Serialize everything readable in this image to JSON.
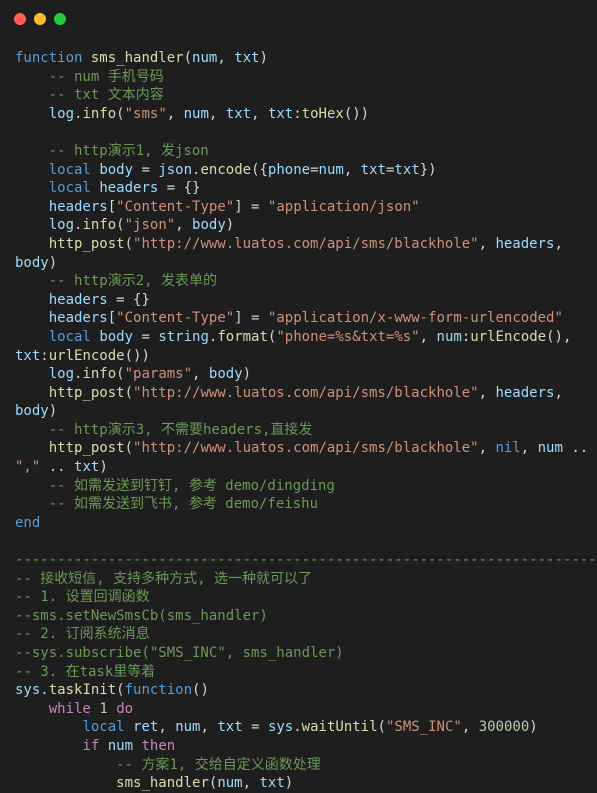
{
  "window": {
    "buttons": {
      "close_color": "#ff5f56",
      "minimize_color": "#ffbd2e",
      "maximize_color": "#27c93f"
    }
  },
  "theme": {
    "background": "#1e1e1e",
    "keyword": "#c586c0",
    "keyword_blue": "#569cd6",
    "function": "#dcdcaa",
    "variable": "#9cdcfe",
    "string": "#ce9178",
    "comment": "#6a9955",
    "number": "#b5cea8",
    "plain": "#d4d4d4"
  },
  "code": {
    "lines": [
      [
        [
          "kwb",
          "function"
        ],
        [
          "plain",
          " "
        ],
        [
          "fn",
          "sms_handler"
        ],
        [
          "plain",
          "("
        ],
        [
          "var",
          "num"
        ],
        [
          "plain",
          ", "
        ],
        [
          "var",
          "txt"
        ],
        [
          "plain",
          ")"
        ]
      ],
      [
        [
          "plain",
          "    "
        ],
        [
          "com",
          "-- num 手机号码"
        ]
      ],
      [
        [
          "plain",
          "    "
        ],
        [
          "com",
          "-- txt 文本内容"
        ]
      ],
      [
        [
          "plain",
          "    "
        ],
        [
          "var",
          "log"
        ],
        [
          "plain",
          "."
        ],
        [
          "fn",
          "info"
        ],
        [
          "plain",
          "("
        ],
        [
          "str",
          "\"sms\""
        ],
        [
          "plain",
          ", "
        ],
        [
          "var",
          "num"
        ],
        [
          "plain",
          ", "
        ],
        [
          "var",
          "txt"
        ],
        [
          "plain",
          ", "
        ],
        [
          "var",
          "txt"
        ],
        [
          "plain",
          ":"
        ],
        [
          "fn",
          "toHex"
        ],
        [
          "plain",
          "())"
        ]
      ],
      [
        [
          "plain",
          ""
        ]
      ],
      [
        [
          "plain",
          "    "
        ],
        [
          "com",
          "-- http演示1, 发json"
        ]
      ],
      [
        [
          "plain",
          "    "
        ],
        [
          "kwb",
          "local"
        ],
        [
          "plain",
          " "
        ],
        [
          "var",
          "body"
        ],
        [
          "plain",
          " = "
        ],
        [
          "var",
          "json"
        ],
        [
          "plain",
          "."
        ],
        [
          "fn",
          "encode"
        ],
        [
          "plain",
          "({"
        ],
        [
          "var",
          "phone"
        ],
        [
          "plain",
          "="
        ],
        [
          "var",
          "num"
        ],
        [
          "plain",
          ", "
        ],
        [
          "var",
          "txt"
        ],
        [
          "plain",
          "="
        ],
        [
          "var",
          "txt"
        ],
        [
          "plain",
          "})"
        ]
      ],
      [
        [
          "plain",
          "    "
        ],
        [
          "kwb",
          "local"
        ],
        [
          "plain",
          " "
        ],
        [
          "var",
          "headers"
        ],
        [
          "plain",
          " = {}"
        ]
      ],
      [
        [
          "plain",
          "    "
        ],
        [
          "var",
          "headers"
        ],
        [
          "plain",
          "["
        ],
        [
          "str",
          "\"Content-Type\""
        ],
        [
          "plain",
          "] = "
        ],
        [
          "str",
          "\"application/json\""
        ]
      ],
      [
        [
          "plain",
          "    "
        ],
        [
          "var",
          "log"
        ],
        [
          "plain",
          "."
        ],
        [
          "fn",
          "info"
        ],
        [
          "plain",
          "("
        ],
        [
          "str",
          "\"json\""
        ],
        [
          "plain",
          ", "
        ],
        [
          "var",
          "body"
        ],
        [
          "plain",
          ")"
        ]
      ],
      [
        [
          "plain",
          "    "
        ],
        [
          "fn",
          "http_post"
        ],
        [
          "plain",
          "("
        ],
        [
          "str",
          "\"http://www.luatos.com/api/sms/blackhole\""
        ],
        [
          "plain",
          ", "
        ],
        [
          "var",
          "headers"
        ],
        [
          "plain",
          ","
        ]
      ],
      [
        [
          "var",
          "body"
        ],
        [
          "plain",
          ")"
        ]
      ],
      [
        [
          "plain",
          "    "
        ],
        [
          "com",
          "-- http演示2, 发表单的"
        ]
      ],
      [
        [
          "plain",
          "    "
        ],
        [
          "var",
          "headers"
        ],
        [
          "plain",
          " = {}"
        ]
      ],
      [
        [
          "plain",
          "    "
        ],
        [
          "var",
          "headers"
        ],
        [
          "plain",
          "["
        ],
        [
          "str",
          "\"Content-Type\""
        ],
        [
          "plain",
          "] = "
        ],
        [
          "str",
          "\"application/x-www-form-urlencoded\""
        ]
      ],
      [
        [
          "plain",
          "    "
        ],
        [
          "kwb",
          "local"
        ],
        [
          "plain",
          " "
        ],
        [
          "var",
          "body"
        ],
        [
          "plain",
          " = "
        ],
        [
          "var",
          "string"
        ],
        [
          "plain",
          "."
        ],
        [
          "fn",
          "format"
        ],
        [
          "plain",
          "("
        ],
        [
          "str",
          "\"phone=%s&txt=%s\""
        ],
        [
          "plain",
          ", "
        ],
        [
          "var",
          "num"
        ],
        [
          "plain",
          ":"
        ],
        [
          "fn",
          "urlEncode"
        ],
        [
          "plain",
          "(),"
        ]
      ],
      [
        [
          "var",
          "txt"
        ],
        [
          "plain",
          ":"
        ],
        [
          "fn",
          "urlEncode"
        ],
        [
          "plain",
          "())"
        ]
      ],
      [
        [
          "plain",
          "    "
        ],
        [
          "var",
          "log"
        ],
        [
          "plain",
          "."
        ],
        [
          "fn",
          "info"
        ],
        [
          "plain",
          "("
        ],
        [
          "str",
          "\"params\""
        ],
        [
          "plain",
          ", "
        ],
        [
          "var",
          "body"
        ],
        [
          "plain",
          ")"
        ]
      ],
      [
        [
          "plain",
          "    "
        ],
        [
          "fn",
          "http_post"
        ],
        [
          "plain",
          "("
        ],
        [
          "str",
          "\"http://www.luatos.com/api/sms/blackhole\""
        ],
        [
          "plain",
          ", "
        ],
        [
          "var",
          "headers"
        ],
        [
          "plain",
          ","
        ]
      ],
      [
        [
          "var",
          "body"
        ],
        [
          "plain",
          ")"
        ]
      ],
      [
        [
          "plain",
          "    "
        ],
        [
          "com",
          "-- http演示3, 不需要headers,直接发"
        ]
      ],
      [
        [
          "plain",
          "    "
        ],
        [
          "fn",
          "http_post"
        ],
        [
          "plain",
          "("
        ],
        [
          "str",
          "\"http://www.luatos.com/api/sms/blackhole\""
        ],
        [
          "plain",
          ", "
        ],
        [
          "kwb",
          "nil"
        ],
        [
          "plain",
          ", "
        ],
        [
          "var",
          "num"
        ],
        [
          "plain",
          " .."
        ]
      ],
      [
        [
          "str",
          "\",\""
        ],
        [
          "plain",
          " .. "
        ],
        [
          "var",
          "txt"
        ],
        [
          "plain",
          ")"
        ]
      ],
      [
        [
          "plain",
          "    "
        ],
        [
          "com",
          "-- 如需发送到钉钉, 参考 demo/dingding"
        ]
      ],
      [
        [
          "plain",
          "    "
        ],
        [
          "com",
          "-- 如需发送到飞书, 参考 demo/feishu"
        ]
      ],
      [
        [
          "kwb",
          "end"
        ]
      ],
      [
        [
          "plain",
          ""
        ]
      ],
      [
        [
          "com",
          "------------------------------------------------------------------------"
        ]
      ],
      [
        [
          "com",
          "-- 接收短信, 支持多种方式, 选一种就可以了"
        ]
      ],
      [
        [
          "com",
          "-- 1. 设置回调函数"
        ]
      ],
      [
        [
          "com",
          "--sms.setNewSmsCb(sms_handler)"
        ]
      ],
      [
        [
          "com",
          "-- 2. 订阅系统消息"
        ]
      ],
      [
        [
          "com",
          "--sys.subscribe(\"SMS_INC\", sms_handler)"
        ]
      ],
      [
        [
          "com",
          "-- 3. 在task里等着"
        ]
      ],
      [
        [
          "var",
          "sys"
        ],
        [
          "plain",
          "."
        ],
        [
          "fn",
          "taskInit"
        ],
        [
          "plain",
          "("
        ],
        [
          "kwb",
          "function"
        ],
        [
          "plain",
          "()"
        ]
      ],
      [
        [
          "plain",
          "    "
        ],
        [
          "kw",
          "while"
        ],
        [
          "plain",
          " "
        ],
        [
          "num",
          "1"
        ],
        [
          "plain",
          " "
        ],
        [
          "kw",
          "do"
        ]
      ],
      [
        [
          "plain",
          "        "
        ],
        [
          "kwb",
          "local"
        ],
        [
          "plain",
          " "
        ],
        [
          "var",
          "ret"
        ],
        [
          "plain",
          ", "
        ],
        [
          "var",
          "num"
        ],
        [
          "plain",
          ", "
        ],
        [
          "var",
          "txt"
        ],
        [
          "plain",
          " = "
        ],
        [
          "var",
          "sys"
        ],
        [
          "plain",
          "."
        ],
        [
          "fn",
          "waitUntil"
        ],
        [
          "plain",
          "("
        ],
        [
          "str",
          "\"SMS_INC\""
        ],
        [
          "plain",
          ", "
        ],
        [
          "num",
          "300000"
        ],
        [
          "plain",
          ")"
        ]
      ],
      [
        [
          "plain",
          "        "
        ],
        [
          "kw",
          "if"
        ],
        [
          "plain",
          " "
        ],
        [
          "var",
          "num"
        ],
        [
          "plain",
          " "
        ],
        [
          "kw",
          "then"
        ]
      ],
      [
        [
          "plain",
          "            "
        ],
        [
          "com",
          "-- 方案1, 交给自定义函数处理"
        ]
      ],
      [
        [
          "plain",
          "            "
        ],
        [
          "fn",
          "sms_handler"
        ],
        [
          "plain",
          "("
        ],
        [
          "var",
          "num"
        ],
        [
          "plain",
          ", "
        ],
        [
          "var",
          "txt"
        ],
        [
          "plain",
          ")"
        ]
      ]
    ]
  }
}
